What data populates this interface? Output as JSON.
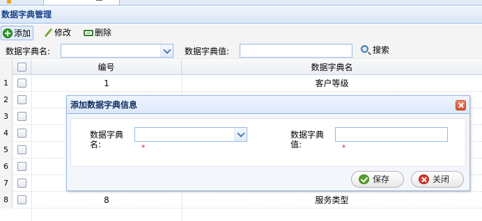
{
  "panel": {
    "title": "数据字典管理"
  },
  "toolbar": {
    "add_label": "添加",
    "edit_label": "修改",
    "delete_label": "删除"
  },
  "search": {
    "name_label": "数据字典名:",
    "name_value": "",
    "value_label": "数据字典值:",
    "value_value": "",
    "search_label": "搜索"
  },
  "grid": {
    "columns": [
      "编号",
      "数据字典名"
    ],
    "rows": [
      {
        "num": "1",
        "id": "1",
        "name": "客户等级"
      },
      {
        "num": "2",
        "id": "",
        "name": ""
      },
      {
        "num": "3",
        "id": "",
        "name": ""
      },
      {
        "num": "4",
        "id": "",
        "name": ""
      },
      {
        "num": "5",
        "id": "",
        "name": ""
      },
      {
        "num": "6",
        "id": "",
        "name": ""
      },
      {
        "num": "7",
        "id": "",
        "name": ""
      },
      {
        "num": "8",
        "id": "8",
        "name": "服务类型"
      }
    ]
  },
  "dialog": {
    "title": "添加数据字典信息",
    "name_label": "数据字典名:",
    "name_value": "",
    "value_label": "数据字典值:",
    "value_value": "",
    "required_mark": "*",
    "save_label": "保存",
    "close_label": "关闭"
  },
  "colors": {
    "header_text": "#15428b",
    "border": "#95b8e7",
    "required": "#e21c1c"
  }
}
